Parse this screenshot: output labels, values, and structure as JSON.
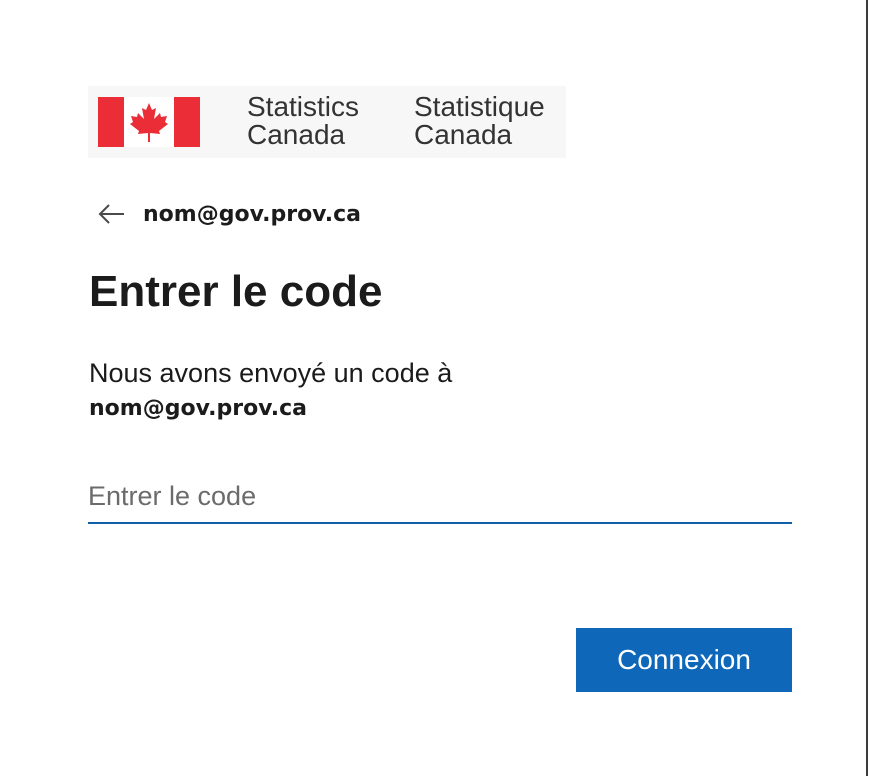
{
  "logo": {
    "name_en_line1": "Statistics",
    "name_en_line2": "Canada",
    "name_fr_line1": "Statistique",
    "name_fr_line2": "Canada",
    "flag_red": "#eb2d37"
  },
  "back": {
    "icon": "arrow-left-icon",
    "email": "nom@gov.prov.ca"
  },
  "title": "Entrer le code",
  "description": {
    "text": "Nous avons envoyé un code à",
    "email": "nom@gov.prov.ca"
  },
  "code_field": {
    "value": "",
    "placeholder": "Entrer le code"
  },
  "submit_label": "Connexion",
  "colors": {
    "accent": "#0f67b9",
    "input_underline": "#0f5fa8"
  }
}
